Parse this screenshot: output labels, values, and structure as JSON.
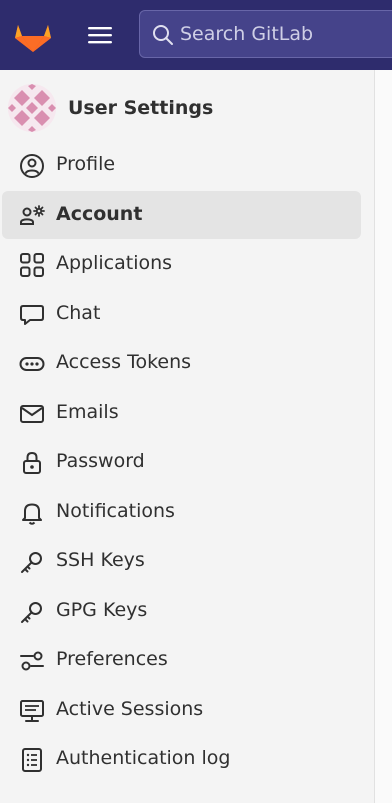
{
  "search": {
    "placeholder": "Search GitLab"
  },
  "sidebar": {
    "title": "User Settings",
    "items": [
      {
        "label": "Profile",
        "icon": "profile-icon",
        "active": false
      },
      {
        "label": "Account",
        "icon": "account-icon",
        "active": true
      },
      {
        "label": "Applications",
        "icon": "applications-icon",
        "active": false
      },
      {
        "label": "Chat",
        "icon": "chat-icon",
        "active": false
      },
      {
        "label": "Access Tokens",
        "icon": "token-icon",
        "active": false
      },
      {
        "label": "Emails",
        "icon": "email-icon",
        "active": false
      },
      {
        "label": "Password",
        "icon": "lock-icon",
        "active": false
      },
      {
        "label": "Notifications",
        "icon": "bell-icon",
        "active": false
      },
      {
        "label": "SSH Keys",
        "icon": "key-icon",
        "active": false
      },
      {
        "label": "GPG Keys",
        "icon": "key-icon",
        "active": false
      },
      {
        "label": "Preferences",
        "icon": "preferences-icon",
        "active": false
      },
      {
        "label": "Active Sessions",
        "icon": "monitor-icon",
        "active": false
      },
      {
        "label": "Authentication log",
        "icon": "log-icon",
        "active": false
      }
    ]
  },
  "colors": {
    "topbar": "#2e2c6d",
    "search_bg": "#45438a",
    "sidebar_bg": "#f4f4f4",
    "active_bg": "#e4e4e4",
    "text": "#303030"
  }
}
